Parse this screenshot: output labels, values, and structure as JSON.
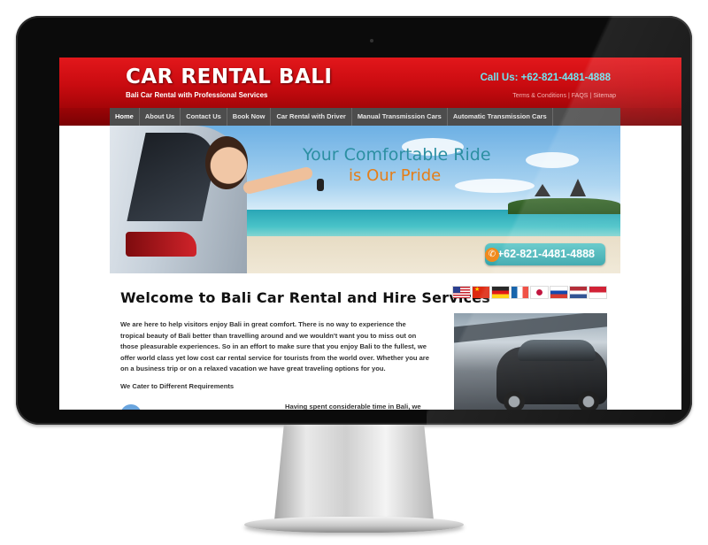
{
  "site": {
    "title": "CAR RENTAL BALI",
    "tagline": "Bali Car Rental with Professional Services",
    "call_us": "Call Us: +62-821-4481-4888",
    "top_links": [
      "Terms & Conditions",
      "FAQS",
      "Sitemap"
    ],
    "link_separator": "|"
  },
  "nav": {
    "items": [
      "Home",
      "About Us",
      "Contact Us",
      "Book Now",
      "Car Rental with Driver",
      "Manual Transmission Cars",
      "Automatic Transmission Cars"
    ],
    "active": "Home"
  },
  "hero": {
    "slogan_line1": "Your Comfortable Ride",
    "slogan_line2": "is Our Pride",
    "phone": "+62-821-4481-4888",
    "phone_icon": "phone-icon"
  },
  "content": {
    "heading": "Welcome to Bali Car Rental and Hire Services",
    "paragraph": "We are here to help visitors enjoy Bali in great comfort. There is no way to experience the tropical beauty of Bali better than travelling around and we wouldn't want you to miss out on those pleasurable experiences. So in an effort to make sure that you enjoy Bali to the fullest, we offer world class yet low cost car rental service for tourists from the world over. Whether you are on a business trip or on a relaxed vacation we have great traveling options for you.",
    "subheading": "We Cater to Different Requirements",
    "teaser": "Having spent considerable time in Bali, we"
  },
  "flags": [
    "flag-us-icon",
    "flag-china-icon",
    "flag-germany-icon",
    "flag-france-icon",
    "flag-japan-icon",
    "flag-russia-icon",
    "flag-netherlands-icon",
    "flag-indonesia-icon"
  ],
  "colors": {
    "header_red": "#d3101a",
    "nav_gray": "#4d4d4d",
    "call_cyan": "#6fe4f0",
    "slogan_teal": "#2c8fa2",
    "slogan_orange": "#e57e18",
    "phone_badge_teal": "#34a4aa"
  }
}
